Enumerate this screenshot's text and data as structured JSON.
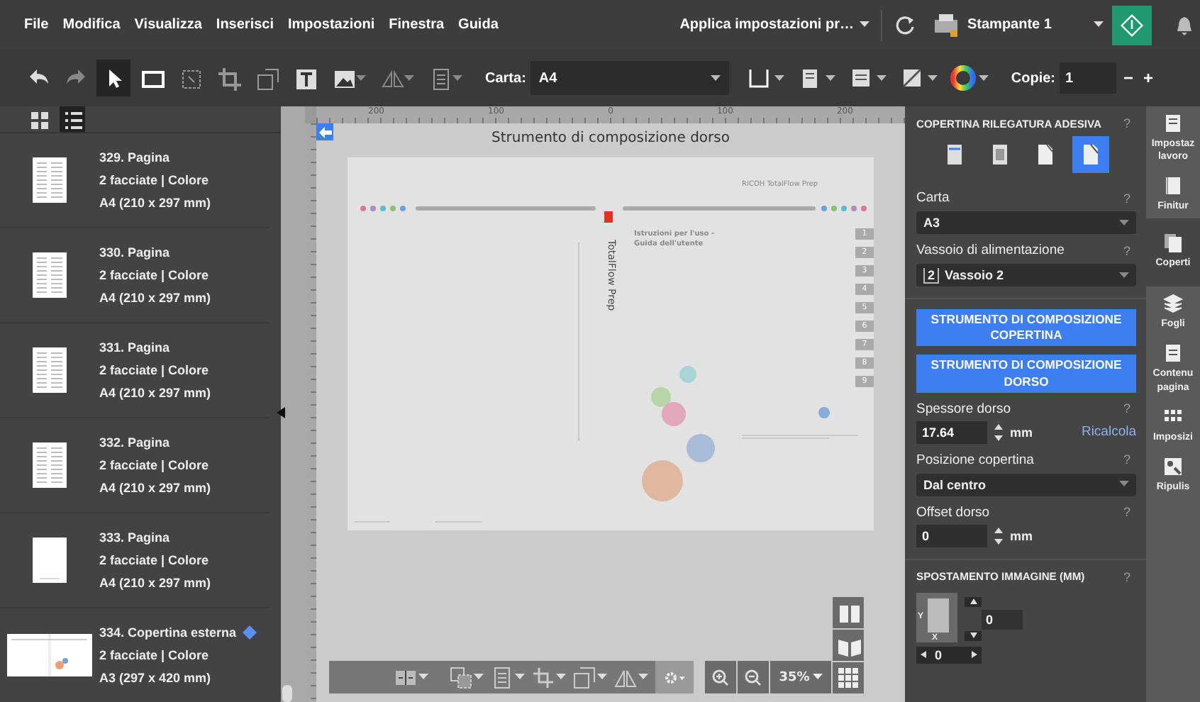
{
  "menu": [
    "File",
    "Modifica",
    "Visualizza",
    "Inserisci",
    "Impostazioni",
    "Finestra",
    "Guida"
  ],
  "apply_settings": {
    "label": "Applica impostazioni pr…"
  },
  "printer": {
    "label": "Stampante 1"
  },
  "tools": [
    {
      "kind": "undo",
      "selected": false
    },
    {
      "kind": "redo",
      "selected": false
    },
    {
      "kind": "pointer",
      "selected": true
    },
    {
      "kind": "rect",
      "selected": false
    },
    {
      "kind": "frame",
      "selected": false
    },
    {
      "kind": "crop",
      "selected": false
    },
    {
      "kind": "resize",
      "selected": false
    },
    {
      "kind": "text",
      "selected": false
    },
    {
      "kind": "image",
      "selected": false
    },
    {
      "kind": "mirror",
      "selected": false
    },
    {
      "kind": "page",
      "selected": false
    }
  ],
  "paper": {
    "label": "Carta:",
    "value": "A4"
  },
  "copies": {
    "label": "Copie:",
    "value": "1",
    "minus": "−",
    "plus": "+"
  },
  "view_modes": [
    {
      "kind": "grid",
      "selected": false
    },
    {
      "kind": "list",
      "selected": true
    }
  ],
  "pages": [
    {
      "title": "329. Pagina",
      "sides": "2 facciate | Colore",
      "size": "A4 (210 x 297 mm)",
      "kind": "text",
      "marked": false
    },
    {
      "title": "330. Pagina",
      "sides": "2 facciate | Colore",
      "size": "A4 (210 x 297 mm)",
      "kind": "text",
      "marked": false
    },
    {
      "title": "331. Pagina",
      "sides": "2 facciate | Colore",
      "size": "A4 (210 x 297 mm)",
      "kind": "text",
      "marked": false
    },
    {
      "title": "332. Pagina",
      "sides": "2 facciate | Colore",
      "size": "A4 (210 x 297 mm)",
      "kind": "text",
      "marked": false
    },
    {
      "title": "333. Pagina",
      "sides": "2 facciate | Colore",
      "size": "A4 (210 x 297 mm)",
      "kind": "blank",
      "marked": false
    },
    {
      "title": "334. Copertina esterna",
      "sides": "2 facciate | Colore",
      "size": "A3 (297 x 420 mm)",
      "kind": "cover",
      "marked": true
    }
  ],
  "ruler": [
    "200",
    "100",
    "0",
    "100",
    "200"
  ],
  "canvas": {
    "title": "Strumento di composizione dorso",
    "brand": "RICOH TotalFlow Prep",
    "doc_title": "Istruzioni per l'uso -\nGuida dell'utente",
    "spine_title": "TotalFlow Prep",
    "tabs": [
      "1",
      "2",
      "3",
      "4",
      "5",
      "6",
      "7",
      "8",
      "9"
    ]
  },
  "zoom": {
    "value": "35%"
  },
  "page_views": [
    {
      "kind": "spread",
      "selected": false
    },
    {
      "kind": "book",
      "selected": false
    }
  ],
  "panel": {
    "title": "COPERTINA RILEGATURA ADESIVA",
    "help": "?",
    "layouts": [
      {
        "kind": "front",
        "selected": false
      },
      {
        "kind": "back",
        "selected": false
      },
      {
        "kind": "fold",
        "selected": false
      },
      {
        "kind": "wrap",
        "selected": true
      }
    ],
    "paper": {
      "label": "Carta",
      "help": "?",
      "value": "A3"
    },
    "tray": {
      "label": "Vassoio di alimentazione",
      "help": "?",
      "number": "2",
      "value": "Vassoio 2"
    },
    "buttons": [
      "STRUMENTO DI COMPOSIZIONE COPERTINA",
      "STRUMENTO DI COMPOSIZIONE DORSO"
    ],
    "spine": {
      "label": "Spessore dorso",
      "help": "?",
      "value": "17.64",
      "unit": "mm",
      "action": "Ricalcola"
    },
    "position": {
      "label": "Posizione copertina",
      "help": "?",
      "value": "Dal centro"
    },
    "offset": {
      "label": "Offset dorso",
      "help": "?",
      "value": "0",
      "unit": "mm"
    },
    "shift": {
      "title": "SPOSTAMENTO IMMAGINE (MM)",
      "help": "?",
      "y_label": "Y",
      "x_label": "X",
      "y_value": "0",
      "x_value": "0"
    }
  },
  "side_tabs": [
    {
      "label": "Impostaz\nlavoro",
      "kind": "job",
      "selected": false
    },
    {
      "label": "Finitur",
      "kind": "finish",
      "selected": false
    },
    {
      "label": "Coperti",
      "kind": "cover",
      "selected": true
    },
    {
      "label": "Fogli",
      "kind": "sheets",
      "selected": false
    },
    {
      "label": "Contenu\npagina",
      "kind": "content",
      "selected": false
    },
    {
      "label": "Imposizi",
      "kind": "impose",
      "selected": false
    },
    {
      "label": "Ripulis",
      "kind": "clean",
      "selected": false
    }
  ]
}
